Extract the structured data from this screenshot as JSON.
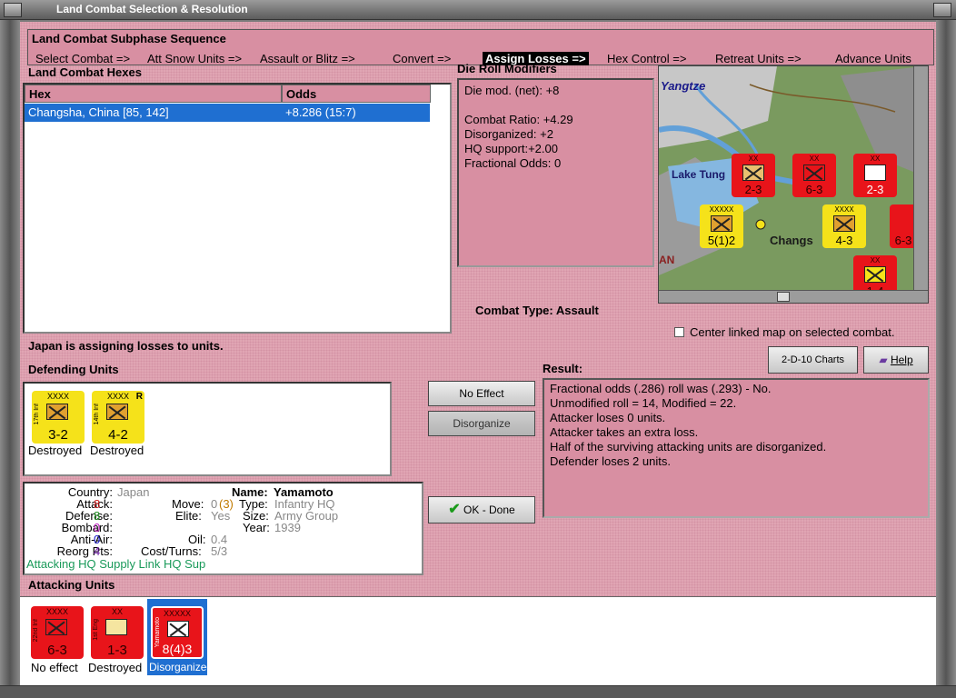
{
  "window": {
    "title": "Land Combat Selection & Resolution"
  },
  "sequence": {
    "title": "Land Combat Subphase Sequence",
    "steps": [
      "Select Combat =>",
      "Att Snow Units =>",
      "Assault or Blitz =>",
      "Convert =>",
      "Assign Losses =>",
      "Hex Control =>",
      "Retreat Units =>",
      "Advance Units"
    ],
    "active_step": "Assign Losses =>"
  },
  "hexes": {
    "label": "Land Combat Hexes",
    "col_hex": "Hex",
    "col_odds": "Odds",
    "rows": [
      {
        "hex": "Changsha, China [85, 142]",
        "odds": "+8.286 (15:7)"
      }
    ]
  },
  "die_mod": {
    "label": "Die Roll Modifiers",
    "net": "Die mod. (net): +8",
    "ratio": "Combat Ratio: +4.29",
    "disorg": "Disorganized: +2",
    "hq": "HQ support:+2.00",
    "frac": "Fractional Odds: 0"
  },
  "combat_type": {
    "label": "Combat Type:",
    "value": "Assault"
  },
  "center_map_label": "Center linked map on selected combat.",
  "status_text": "Japan is assigning losses to units.",
  "defending": {
    "label": "Defending Units",
    "units": [
      {
        "name": "17th Inf",
        "size": "XXXX",
        "value": "3-2",
        "status": "Destroyed",
        "r": ""
      },
      {
        "name": "14th Inf",
        "size": "XXXX",
        "value": "4-2",
        "status": "Destroyed",
        "r": "R"
      }
    ]
  },
  "buttons": {
    "no_effect": "No Effect",
    "disorganize": "Disorganize",
    "ok_done": "OK - Done",
    "charts": "2-D-10 Charts",
    "help": "Help"
  },
  "result": {
    "label": "Result:",
    "lines": [
      "Fractional odds (.286) roll was (.293)  - No.",
      "Unmodified roll = 14, Modified = 22.",
      "Attacker loses 0 units.",
      "Attacker takes an extra loss.",
      "Half of the surviving attacking units are disorganized.",
      "Defender loses 2 units."
    ]
  },
  "info": {
    "country_l": "Country:",
    "country_v": "Japan",
    "attack_l": "Attack:",
    "attack_v": "8",
    "defense_l": "Defense:",
    "defense_v": "8",
    "bombard_l": "Bombard:",
    "bombard_v": "0",
    "antiair_l": "Anti-Air:",
    "antiair_v": "0",
    "reorg_l": "Reorg Pts:",
    "reorg_v": "4",
    "name_l": "Name:",
    "name_v": "Yamamoto",
    "move_l": "Move:",
    "move_v": "0",
    "move_v2": "(3)",
    "elite_l": "Elite:",
    "elite_v": "Yes",
    "type_l": "Type:",
    "type_v": "Infantry HQ",
    "size_l": "Size:",
    "size_v": "Army Group",
    "year_l": "Year:",
    "year_v": "1939",
    "oil_l": "Oil:",
    "oil_v": "0.4",
    "cost_l": "Cost/Turns:",
    "cost_v": "5/3",
    "footer": "Attacking HQ Supply Link HQ Sup"
  },
  "attacking": {
    "label": "Attacking Units",
    "units": [
      {
        "name": "22nd Inf",
        "size": "XXXX",
        "value": "6-3",
        "status": "No effect"
      },
      {
        "name": "1st Eng",
        "size": "XX",
        "value": "1-3",
        "status": "Destroyed"
      },
      {
        "name": "Yamamoto",
        "size": "XXXXX",
        "value": "8(4)3",
        "status": "Disorganized"
      }
    ]
  },
  "map": {
    "labels": [
      "Yangtze",
      "Lake Tung",
      "Changs",
      "AN"
    ],
    "units": [
      {
        "val": "2-3",
        "size": "XX"
      },
      {
        "val": "6-3",
        "size": "XX"
      },
      {
        "val": "2-3",
        "size": "XX"
      },
      {
        "val": "5(1)2",
        "size": "XXXXX"
      },
      {
        "val": "4-3",
        "size": "XXXX"
      },
      {
        "val": "6-3",
        "size": ""
      },
      {
        "val": "1-4",
        "size": "XX"
      }
    ]
  }
}
